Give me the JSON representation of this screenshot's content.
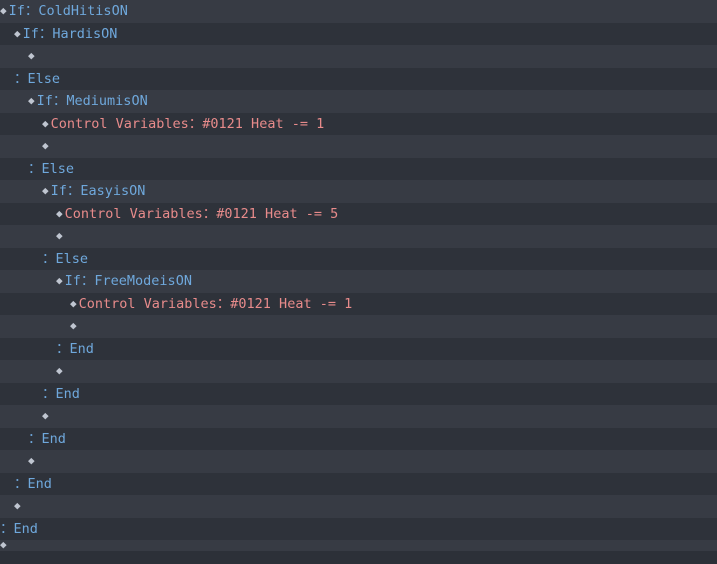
{
  "tokens": {
    "if": "If",
    "else": "Else",
    "end": "End",
    "sep": "：",
    "is": "is",
    "on": "ON"
  },
  "switches": {
    "coldhit": "ColdHit",
    "hard": "Hard",
    "medium": "Medium",
    "easy": "Easy",
    "freemode": "FreeMode"
  },
  "commands": {
    "cv_heat_m1": "Control Variables：#0121 Heat -= 1",
    "cv_heat_m5": "Control Variables：#0121 Heat -= 5"
  }
}
